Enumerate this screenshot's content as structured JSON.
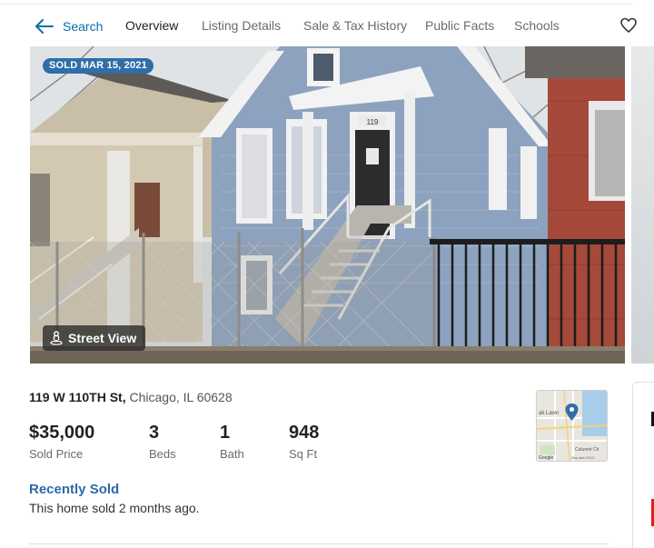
{
  "nav": {
    "back_label": "Search",
    "tabs": [
      {
        "label": "Overview",
        "active": true
      },
      {
        "label": "Listing Details",
        "active": false
      },
      {
        "label": "Sale & Tax History",
        "active": false
      },
      {
        "label": "Public Facts",
        "active": false
      },
      {
        "label": "Schools",
        "active": false
      }
    ]
  },
  "photo": {
    "sold_badge": "SOLD MAR 15, 2021",
    "street_view_label": "Street View",
    "house_number": "119"
  },
  "listing": {
    "street": "119 W 110TH St,",
    "city_state_zip": "Chicago, IL 60628",
    "stats": [
      {
        "value": "$35,000",
        "label": "Sold Price"
      },
      {
        "value": "3",
        "label": "Beds"
      },
      {
        "value": "1",
        "label": "Bath"
      },
      {
        "value": "948",
        "label": "Sq Ft"
      }
    ],
    "status_title": "Recently Sold",
    "status_note": "This home sold 2 months ago."
  },
  "map": {
    "place_label_1": "ak Lawn",
    "place_label_2": "Calumet Cit",
    "brand": "Google",
    "attribution": "Map data ©2021"
  },
  "colors": {
    "accent": "#2d6aa8",
    "badge": "#2f6ea8",
    "link": "#0a6fa8"
  },
  "icons": [
    "arrow-left-icon",
    "heart-icon",
    "street-view-person-icon",
    "map-pin-icon"
  ]
}
